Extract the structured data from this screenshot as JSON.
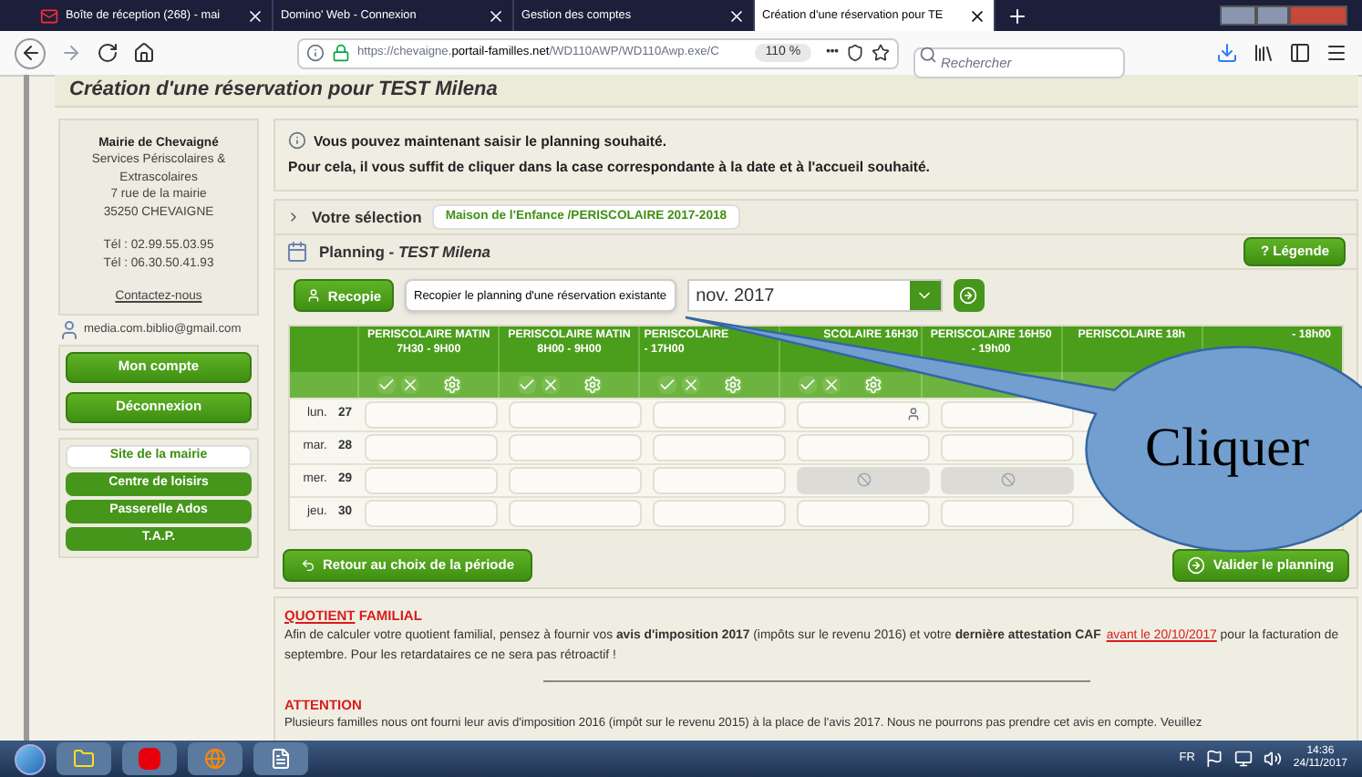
{
  "browser": {
    "tabs": [
      {
        "label": "Boîte de réception (268) - mai",
        "kind": "mail",
        "selected": false
      },
      {
        "label": "Domino' Web - Connexion",
        "kind": "page",
        "selected": false
      },
      {
        "label": "Gestion des comptes",
        "kind": "page",
        "selected": false
      },
      {
        "label": "Création d'une réservation pour TE",
        "kind": "page",
        "selected": true
      }
    ],
    "url": {
      "prefix": "https://chevaigne.",
      "domain": "portail-familles.net",
      "path": "/WD110AWP/WD110Awp.exe/C"
    },
    "zoom": "110 %",
    "more": "•••",
    "search_placeholder": "Rechercher"
  },
  "page_title": "Création d'une réservation pour TEST Milena",
  "sidebar": {
    "org": "Mairie de Chevaigné",
    "lines": [
      "Services Périscolaires &",
      "Extrascolaires",
      "7 rue de la mairie",
      "35250 CHEVAIGNE"
    ],
    "phones": [
      "Tél : 02.99.55.03.95",
      "Tél : 06.30.50.41.93"
    ],
    "contact": "Contactez-nous",
    "user": "media.com.biblio@gmail.com",
    "buttons": [
      "Mon compte",
      "Déconnexion"
    ],
    "links": [
      {
        "label": "Site de la mairie",
        "selected": true
      },
      {
        "label": "Centre de loisirs",
        "selected": false
      },
      {
        "label": "Passerelle Ados",
        "selected": false
      },
      {
        "label": "T.A.P.",
        "selected": false
      }
    ]
  },
  "info": [
    "Vous pouvez maintenant saisir le planning souhaité.",
    "Pour cela, il vous suffit de cliquer dans la case correspondante à la date et à l'accueil souhaité."
  ],
  "selection": {
    "label": "Votre sélection",
    "value": "Maison de l'Enfance /PERISCOLAIRE 2017-2018"
  },
  "planning": {
    "title": "Planning -",
    "name": "TEST Milena",
    "legend": "? Légende",
    "copy": "Recopie",
    "copy_tooltip": "Recopier le planning d'une réservation existante",
    "month": "nov. 2017",
    "columns": [
      {
        "lines": [
          "PERISCOLAIRE MATIN",
          "7H30 - 9H00"
        ],
        "actions": true
      },
      {
        "lines": [
          "PERISCOLAIRE MATIN",
          "8H00 - 9H00"
        ],
        "actions": true
      },
      {
        "lines": [
          "PERISCOLAIRE",
          "- 17H00"
        ],
        "actions": true
      },
      {
        "lines": [
          "SCOLAIRE 16H30"
        ],
        "actions": true
      },
      {
        "lines": [
          "PERISCOLAIRE 16H50",
          "- 19h00"
        ],
        "actions": false
      },
      {
        "lines": [
          "PERISCOLAIRE 18h"
        ],
        "actions": false
      },
      {
        "lines": [
          "- 18h00"
        ]
      }
    ],
    "rows": [
      {
        "day": "lun.",
        "date": "27",
        "cells": [
          {
            "kind": "empty"
          },
          {
            "kind": "empty"
          },
          {
            "kind": "empty"
          },
          {
            "kind": "person"
          },
          {
            "kind": "empty"
          }
        ]
      },
      {
        "day": "mar.",
        "date": "28",
        "cells": [
          {
            "kind": "empty"
          },
          {
            "kind": "empty"
          },
          {
            "kind": "empty"
          },
          {
            "kind": "empty"
          },
          {
            "kind": "empty"
          }
        ]
      },
      {
        "day": "mer.",
        "date": "29",
        "cells": [
          {
            "kind": "empty"
          },
          {
            "kind": "empty"
          },
          {
            "kind": "empty"
          },
          {
            "kind": "closed"
          },
          {
            "kind": "closed"
          }
        ]
      },
      {
        "day": "jeu.",
        "date": "30",
        "cells": [
          {
            "kind": "empty"
          },
          {
            "kind": "empty"
          },
          {
            "kind": "empty"
          },
          {
            "kind": "empty"
          },
          {
            "kind": "empty"
          }
        ]
      }
    ],
    "back": "Retour au choix de la période",
    "validate": "Valider le planning"
  },
  "notice": {
    "heading_underlined": "QUOTIENT",
    "heading_rest": "FAMILIAL",
    "paragraph": [
      {
        "kind": "plain",
        "text": "Afin de calculer votre quotient familial, pensez à fournir vos "
      },
      {
        "kind": "bold",
        "text": "avis d'imposition 2017"
      },
      {
        "kind": "plain",
        "text": " (impôts sur le revenu 2016) et votre "
      },
      {
        "kind": "bold",
        "text": "dernière attestation CAF"
      },
      {
        "kind": "link",
        "text": "avant le 20/10/2017"
      },
      {
        "kind": "plain",
        "text": " pour la facturation de septembre. Pour les retardataires ce ne sera pas rétroactif !"
      }
    ],
    "attention": "ATTENTION",
    "attention_text": "Plusieurs familles nous ont fourni leur avis d'imposition 2016 (impôt sur le revenu 2015) à la place de l'avis 2017. Nous ne pourrons pas prendre cet avis en compte. Veuillez"
  },
  "callout": "Cliquer",
  "taskbar": {
    "lang": "FR",
    "time": "14:36",
    "date": "24/11/2017"
  }
}
